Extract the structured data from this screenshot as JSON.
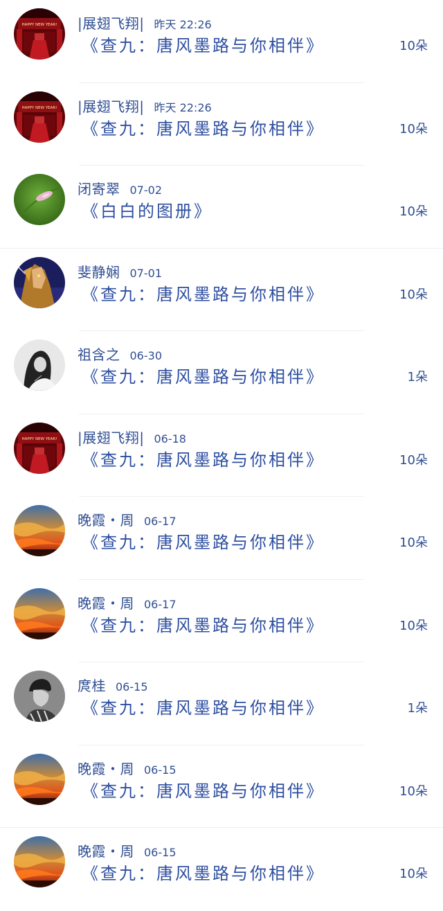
{
  "items": [
    {
      "user": "|展翅飞翔|",
      "time": "昨天 22:26",
      "album": "《查九：唐风墨路与你相伴》",
      "count": "10朵",
      "avatar_icon": "red-stage-avatar-icon"
    },
    {
      "user": "|展翅飞翔|",
      "time": "昨天 22:26",
      "album": "《查九：唐风墨路与你相伴》",
      "count": "10朵",
      "avatar_icon": "red-stage-avatar-icon"
    },
    {
      "user": "闭寄翠",
      "time": "07-02",
      "album": "《白白的图册》",
      "count": "10朵",
      "avatar_icon": "green-leaf-avatar-icon"
    },
    {
      "user": "斐静娴",
      "time": "07-01",
      "album": "《查九：唐风墨路与你相伴》",
      "count": "10朵",
      "avatar_icon": "fantasy-portrait-avatar-icon"
    },
    {
      "user": "祖含之",
      "time": "06-30",
      "album": "《查九：唐风墨路与你相伴》",
      "count": "1朵",
      "avatar_icon": "girl-portrait-avatar-icon"
    },
    {
      "user": "|展翅飞翔|",
      "time": "06-18",
      "album": "《查九：唐风墨路与你相伴》",
      "count": "10朵",
      "avatar_icon": "red-stage-avatar-icon"
    },
    {
      "user": "晚霞・周",
      "time": "06-17",
      "album": "《查九：唐风墨路与你相伴》",
      "count": "10朵",
      "avatar_icon": "sunset-avatar-icon"
    },
    {
      "user": "晚霞・周",
      "time": "06-17",
      "album": "《查九：唐风墨路与你相伴》",
      "count": "10朵",
      "avatar_icon": "sunset-avatar-icon"
    },
    {
      "user": "庹桂",
      "time": "06-15",
      "album": "《查九：唐风墨路与你相伴》",
      "count": "1朵",
      "avatar_icon": "man-portrait-avatar-icon"
    },
    {
      "user": "晚霞・周",
      "time": "06-15",
      "album": "《查九：唐风墨路与你相伴》",
      "count": "10朵",
      "avatar_icon": "sunset-avatar-icon"
    },
    {
      "user": "晚霞・周",
      "time": "06-15",
      "album": "《查九：唐风墨路与你相伴》",
      "count": "10朵",
      "avatar_icon": "sunset-avatar-icon"
    }
  ],
  "colors": {
    "text": "#2f4e93",
    "album_text": "#2d4ea0",
    "divider": "#eceff4"
  }
}
